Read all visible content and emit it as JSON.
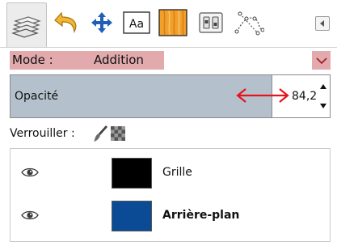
{
  "tabs": [
    {
      "name": "layers",
      "icon": "layers-stack-icon",
      "active": true
    },
    {
      "name": "undo-history",
      "icon": "undo-arrow-icon",
      "active": false
    },
    {
      "name": "tool-move",
      "icon": "move-cross-icon",
      "active": false
    },
    {
      "name": "fonts",
      "icon": "fonts-icon",
      "active": false
    },
    {
      "name": "patterns",
      "icon": "wood-pattern-icon",
      "active": false
    },
    {
      "name": "tool-options",
      "icon": "tool-options-icon",
      "active": false
    },
    {
      "name": "paths",
      "icon": "paths-icon",
      "active": false
    }
  ],
  "mode": {
    "label": "Mode :",
    "value": "Addition"
  },
  "opacity": {
    "label": "Opacité",
    "value": "84,2"
  },
  "lock": {
    "label": "Verrouiller :"
  },
  "layers": [
    {
      "name": "Grille",
      "visible": true,
      "thumb_color": "#000000",
      "selected": false
    },
    {
      "name": "Arrière-plan",
      "visible": true,
      "thumb_color": "#0b4b96",
      "selected": false
    }
  ],
  "colors": {
    "highlight": "#e2aaad",
    "opacity_fill": "#b4c1cc",
    "arrow": "#e8141b",
    "move_icon": "#1f5fb6",
    "undo_icon": "#f2b632",
    "wood": "#f2a02c"
  }
}
